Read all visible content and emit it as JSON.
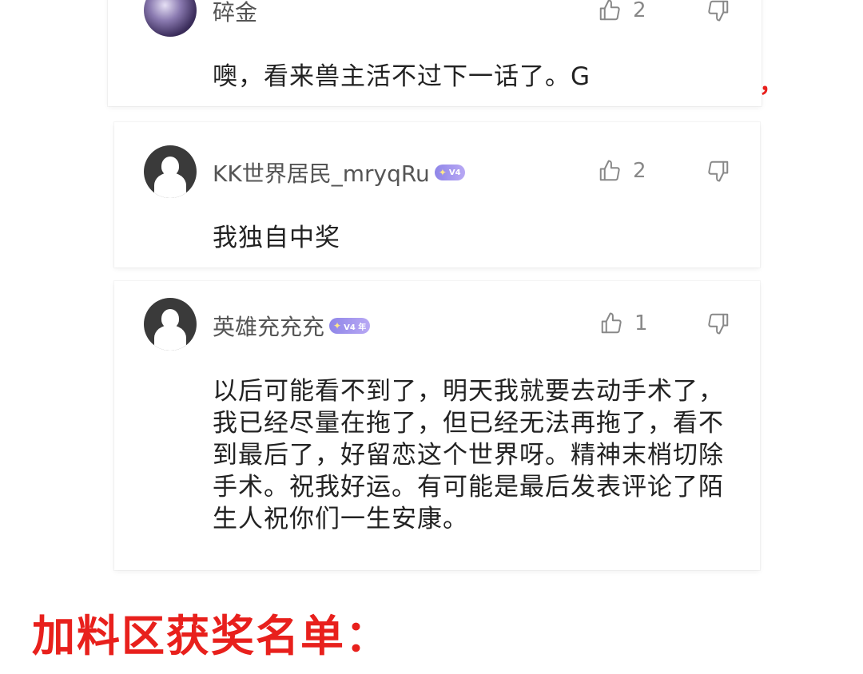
{
  "comments": [
    {
      "username": "碎金",
      "badge": null,
      "likes": "2",
      "text": "噢，看来兽主活不过下一话了。G"
    },
    {
      "username": "KK世界居民_mryqRu",
      "badge": "V4",
      "likes": "2",
      "text": "我独自中奖"
    },
    {
      "username": "英雄充充充",
      "badge": "V4 年",
      "likes": "1",
      "text": "以后可能看不到了，明天我就要去动手术了，我已经尽量在拖了，但已经无法再拖了，看不到最后了，好留恋这个世界呀。精神末梢切除手术。祝我好运。有可能是最后发表评论了陌生人祝你们一生安康。"
    }
  ],
  "overlay": {
    "prize_title": "加料区获奖名单：",
    "red_mark": "，"
  },
  "icons": {
    "like": "thumbs-up-icon",
    "dislike": "thumbs-down-icon",
    "avatar_default": "default-avatar-icon",
    "badge_crown": "crown-icon"
  },
  "colors": {
    "accent_red": "#e8201c",
    "badge_purple": "#8f86e8",
    "text_gray": "#555555"
  }
}
